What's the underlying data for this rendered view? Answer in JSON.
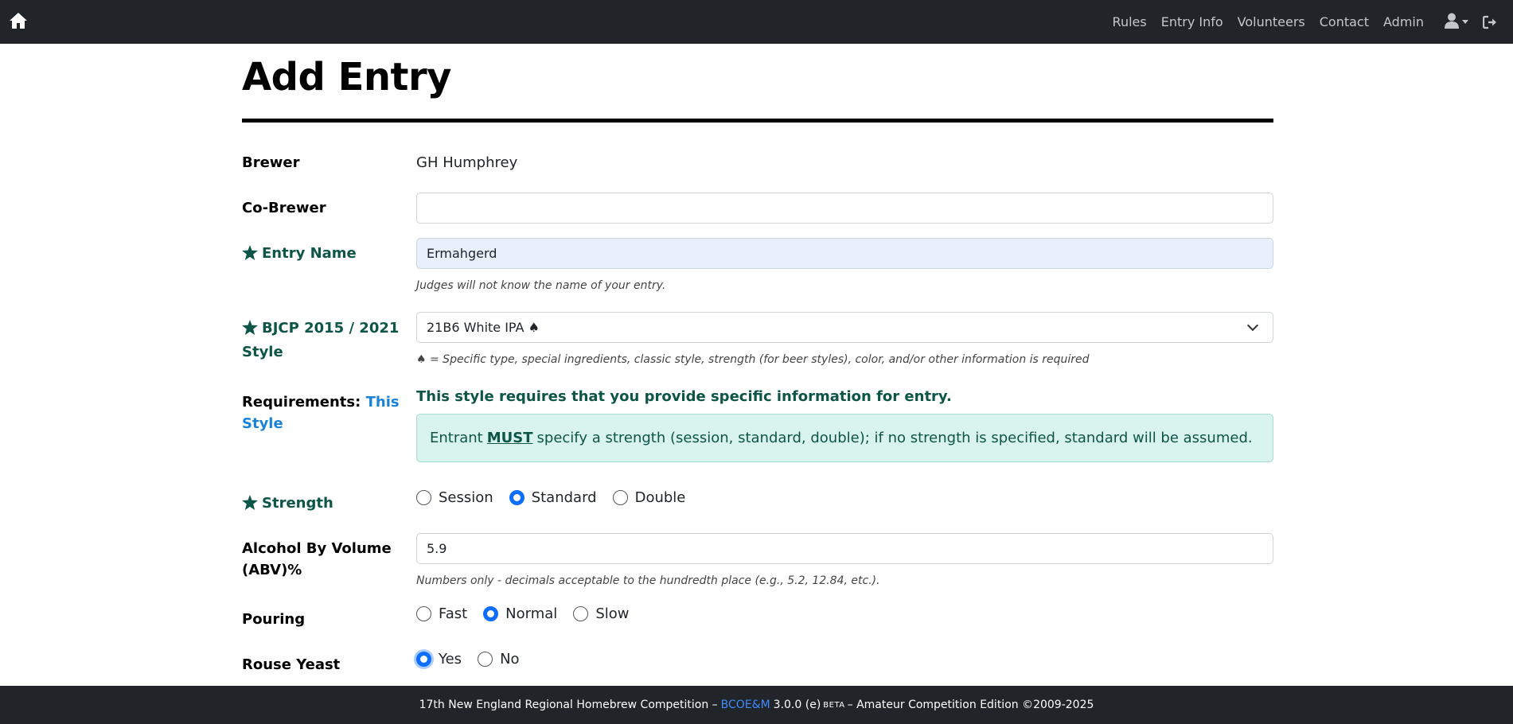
{
  "nav": {
    "home_icon": "home-icon",
    "links": [
      "Rules",
      "Entry Info",
      "Volunteers",
      "Contact",
      "Admin"
    ],
    "user_icon": "user-icon",
    "logout_icon": "logout-icon"
  },
  "page": {
    "title": "Add Entry"
  },
  "form": {
    "brewer": {
      "label": "Brewer",
      "value": "GH Humphrey"
    },
    "co_brewer": {
      "label": "Co-Brewer",
      "value": ""
    },
    "entry_name": {
      "label": "Entry Name",
      "value": "Ermahgerd",
      "help": "Judges will not know the name of your entry."
    },
    "style": {
      "label": "BJCP 2015 / 2021 Style",
      "selected": "21B6 White IPA ♠",
      "help": "♠ = Specific type, special ingredients, classic style, strength (for beer styles), color, and/or other information is required"
    },
    "requirements": {
      "label": "Requirements:",
      "link": "This Style",
      "heading": "This style requires that you provide specific information for entry.",
      "alert_prefix": "Entrant",
      "alert_must": "MUST",
      "alert_suffix": "specify a strength (session, standard, double); if no strength is specified, standard will be assumed."
    },
    "strength": {
      "label": "Strength",
      "options": [
        "Session",
        "Standard",
        "Double"
      ],
      "selected": "Standard"
    },
    "abv": {
      "label": "Alcohol By Volume (ABV)%",
      "value": "5.9",
      "help": "Numbers only - decimals acceptable to the hundredth place (e.g., 5.2, 12.84, etc.)."
    },
    "pouring": {
      "label": "Pouring",
      "options": [
        "Fast",
        "Normal",
        "Slow"
      ],
      "selected": "Normal"
    },
    "rouse_yeast": {
      "label": "Rouse Yeast",
      "options": [
        "Yes",
        "No"
      ],
      "selected": "Yes"
    }
  },
  "footer": {
    "prefix": "17th New England Regional Homebrew Competition –",
    "brand": "BCOE&M",
    "version": "3.0.0 (e)",
    "beta": "BETA",
    "suffix": "– Amateur Competition Edition ©2009-2025"
  },
  "colors": {
    "required": "#0d5547",
    "accent": "#0d6efd",
    "navbar": "#212529"
  }
}
